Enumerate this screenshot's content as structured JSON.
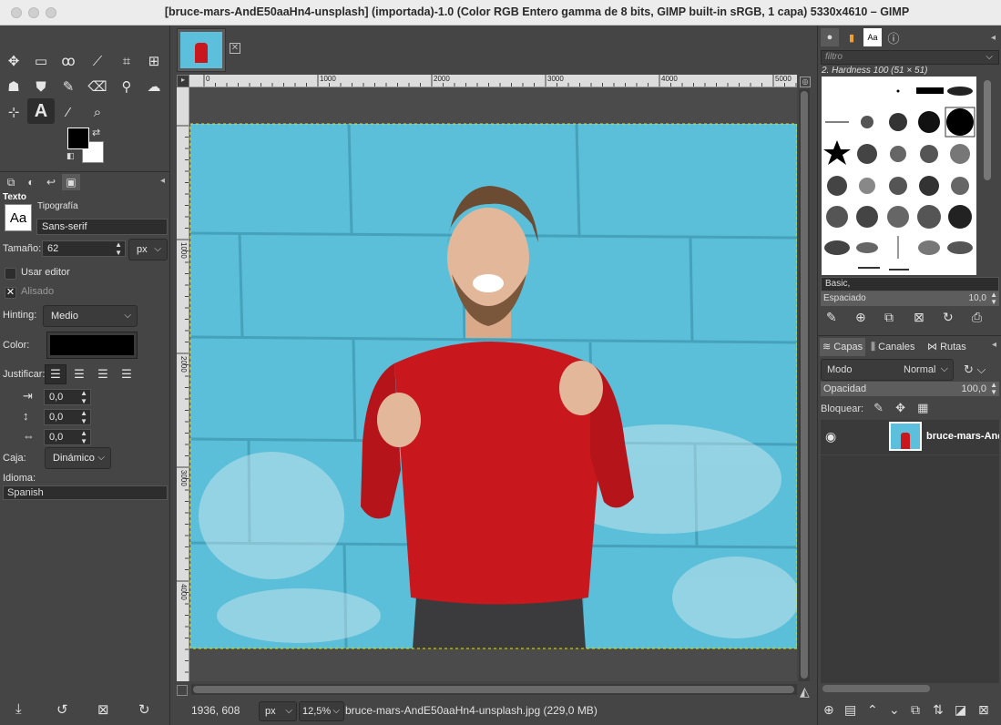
{
  "window": {
    "title": "[bruce-mars-AndE50aaHn4-unsplash] (importada)-1.0 (Color RGB Entero gamma de 8 bits, GIMP built-in sRGB, 1 capa) 5330x4610 – GIMP"
  },
  "toolbox": {
    "tools": [
      "move-icon",
      "rect-select-icon",
      "lasso-icon",
      "fuzzy-select-icon",
      "crop-icon",
      "transform-icon",
      "warp-icon",
      "bucket-fill-icon",
      "paintbrush-icon",
      "eraser-icon",
      "clone-icon",
      "smudge-icon",
      "paths-icon",
      "text-icon",
      "color-picker-icon",
      "zoom-icon"
    ],
    "colors": {
      "foreground": "#000000",
      "background": "#ffffff"
    }
  },
  "tool_options": {
    "section": "Texto",
    "font_label": "Tipografía",
    "font_preview": "Aa",
    "font_value": "Sans-serif",
    "size_label": "Tamaño:",
    "size_value": "62",
    "size_unit": "px",
    "use_editor_label": "Usar editor",
    "antialias_label": "Alisado",
    "hinting_label": "Hinting:",
    "hinting_value": "Medio",
    "color_label": "Color:",
    "color_value": "#000000",
    "justify_label": "Justificar:",
    "indent_value": "0,0",
    "line_spacing_value": "0,0",
    "letter_spacing_value": "0,0",
    "box_label": "Caja:",
    "box_value": "Dinámico",
    "language_label": "Idioma:",
    "language_value": "Spanish"
  },
  "canvas": {
    "ruler_ticks": [
      "0",
      "1000",
      "2000",
      "3000",
      "4000",
      "5000"
    ],
    "vruler_ticks": [
      "1000",
      "2000",
      "3000",
      "4000"
    ],
    "image_colors": {
      "wall": "#5bbfd9",
      "sweater": "#c8171d",
      "skin": "#e3b89a"
    }
  },
  "status": {
    "coords": "1936, 608",
    "unit": "px",
    "zoom": "12,5%",
    "file_info": "bruce-mars-AndE50aaHn4-unsplash.jpg (229,0 MB)"
  },
  "brushes": {
    "filter_placeholder": "filtro",
    "selected_name": "2. Hardness 100 (51 × 51)",
    "tag_value": "Basic,",
    "spacing_label": "Espaciado",
    "spacing_value": "10,0"
  },
  "layers": {
    "tabs": [
      "Capas",
      "Canales",
      "Rutas"
    ],
    "mode_label": "Modo",
    "mode_value": "Normal",
    "opacity_label": "Opacidad",
    "opacity_value": "100,0",
    "lock_label": "Bloquear:",
    "layer_name": "bruce-mars-AndE"
  }
}
